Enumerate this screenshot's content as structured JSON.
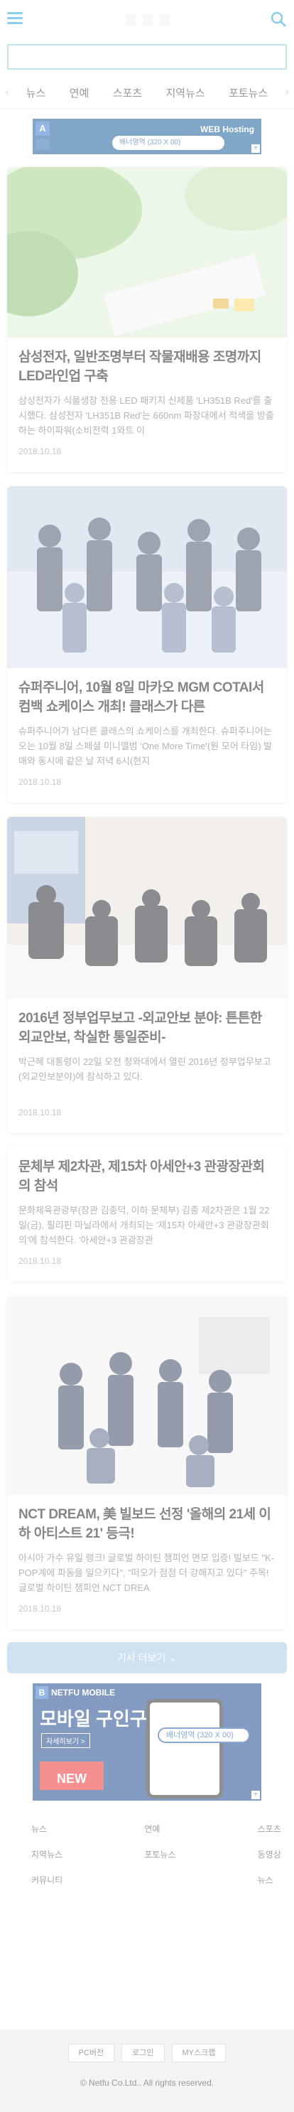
{
  "nav": {
    "tabs": [
      "뉴스",
      "연예",
      "스포츠",
      "지역뉴스",
      "포토뉴스"
    ]
  },
  "banner_top": {
    "text": "WEB Hosting",
    "pill": "배너영역 (320 X 00)"
  },
  "articles": [
    {
      "title": "삼성전자, 일반조명부터 작물재배용 조명까지 LED라인업 구축",
      "summary": "삼성전자가 식물생장 전용 LED 패키지 신제품 'LH351B Red'를 출시했다. 삼성전자 'LH351B Red'는 660nm 파장대에서 적색을 방출하는 하이파워(소비전력 1와트 이",
      "date": "2018.10.18"
    },
    {
      "title": "슈퍼주니어, 10월 8일 마카오 MGM COTAI서 컴백 쇼케이스 개최! 클래스가 다른",
      "summary": "슈퍼주니어가 남다른 클래스의 쇼케이스를 개최한다. 슈퍼주니어는 오는 10월 8일 스페셜 미니앨범 'One More Time'(원 모어 타임) 발매와 동시에 같은 날 저녁 6시(현지",
      "date": "2018.10.18"
    },
    {
      "title": "2016년 정부업무보고 -외교안보 분야: 튼튼한 외교안보, 착실한 통일준비-",
      "summary": "박근혜 대통령이 22일 오전 청와대에서 열린 2016년 정부업무보고(외교안보분야)에 참석하고 있다.",
      "date": "2018.10.18"
    },
    {
      "title": "문체부 제2차관, 제15차 아세안+3 관광장관회의 참석",
      "summary": "문화체육관광부(장관 김종덕, 이하 문체부) 김종 제2차관은 1월 22일(금), 필리핀 마닐라에서 개최되는 '제15차 아세안+3 관광장관회의'에 참석한다. '아세안+3 관광장관",
      "date": "2018.10.18"
    },
    {
      "title": "NCT DREAM, 美 빌보드 선정 '올해의 21세 이하 아티스트 21' 등극!",
      "summary": "아시아 가수 유일 랭크! 글로벌 하이틴 챔피언 면모 입증! 빌보드 \"K-POP계에 파동을 일으키다\", \"떠오가 점점 더 강해지고 있다\" 주목!  글로벌 하이틴 챔피언 NCT DREA",
      "date": "2018.10.18"
    }
  ],
  "more_label": "기사 더보기 ⌄",
  "banner_bottom": {
    "brand": "NETFU MOBILE",
    "headline": "모바일 구인구직",
    "button": "자세히보기 >",
    "pill": "배너영역 (320 X 00)",
    "new": "NEW"
  },
  "footer_menu": [
    "뉴스",
    "연예",
    "스포츠",
    "지역뉴스",
    "포토뉴스",
    "동영상뉴스",
    "커뮤니티"
  ],
  "footer_buttons": [
    "PC버전",
    "로그인",
    "MY스크랩"
  ],
  "copyright": "© Netfu Co.Ltd.. All rights reserved.",
  "colors": {
    "accent": "#2aa3d8",
    "more_button": "#a6cbe8",
    "footer_bg": "#eaeaea"
  }
}
